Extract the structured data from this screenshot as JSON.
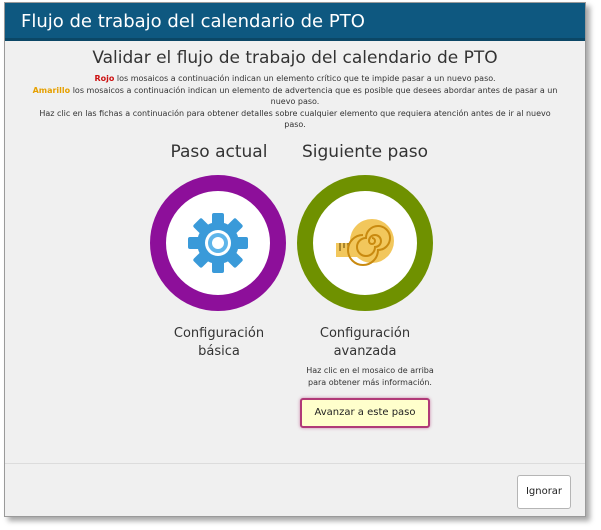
{
  "window": {
    "title": "Flujo de trabajo del calendario de PTO"
  },
  "heading": "Validar el flujo de trabajo del calendario de PTO",
  "legend": {
    "red_keyword": "Rojo",
    "red_text": " los mosaicos a continuación indican un elemento crítico que te impide pasar a un nuevo paso.",
    "yellow_keyword": "Amarillo",
    "yellow_text_line1": " los mosaicos a continuación indican un elemento de advertencia que es posible que desees abordar antes de pasar a un",
    "yellow_text_line2": "nuevo paso.",
    "click_text_line1": "Haz clic en las fichas a continuación para obtener detalles sobre cualquier elemento que requiera atención antes de ir al nuevo",
    "click_text_line2": "paso."
  },
  "steps": [
    {
      "header": "Paso actual",
      "label_line1": "Configuración",
      "label_line2": "básica",
      "icon": "gear-icon",
      "ring_color": "#8d0f9a"
    },
    {
      "header": "Siguiente paso",
      "label_line1": "Configuración",
      "label_line2": "avanzada",
      "icon": "measuring-tape-icon",
      "ring_color": "#6f9100"
    }
  ],
  "hint": {
    "line1": "Haz clic en el mosaico de arriba",
    "line2": "para obtener más información."
  },
  "buttons": {
    "advance": "Avanzar a este paso",
    "ignore": "Ignorar"
  },
  "colors": {
    "titlebar": "#0e5880",
    "critical": "#cc1111",
    "warning": "#e6a000",
    "advance_button_bg": "#ffffcc",
    "advance_button_border": "#b03a78"
  }
}
